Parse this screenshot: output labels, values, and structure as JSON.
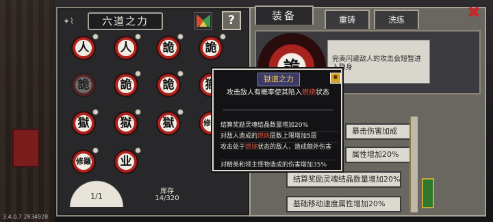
{
  "left_panel": {
    "title": "六道之力",
    "help_label": "?",
    "badges": [
      "人",
      "人",
      "詭",
      "詭",
      "詭",
      "詭",
      "詭",
      "獄",
      "獄",
      "獄",
      "獄",
      "修羅",
      "修羅",
      "业"
    ],
    "fan_page": "1/1",
    "stock_label": "库存",
    "stock_count": "14/320"
  },
  "right_panel": {
    "tabs": [
      "装备",
      "重铸",
      "洗练"
    ],
    "big_badge": "詭",
    "description": "完美闪避敌人的攻击会短暂进入隐身",
    "stats": [
      "暴击伤害加成",
      "属性增加20%",
      "结算奖励灵魂结晶数量增加20%",
      "基础移动速度属性增加20%"
    ]
  },
  "tooltip": {
    "title": "獄道之力",
    "main_before": "攻击敌人有概率使其陷入",
    "main_fire": "燃烧",
    "main_after": "状态",
    "lines": [
      {
        "before": "结算奖励灵魂结晶数量增加20%",
        "fire": "",
        "after": ""
      },
      {
        "before": "对敌人造成的",
        "fire": "燃烧",
        "after": "层数上限增加5层"
      },
      {
        "before": "攻击处于",
        "fire": "燃烧",
        "after": "状态的敌人，造成额外伤害"
      },
      {
        "before": "对精英和领主怪物造成的伤害增加35%",
        "fire": "",
        "after": ""
      }
    ]
  },
  "version": "3.4.0.7 2834928",
  "colors": {
    "accent_red": "#b0221e",
    "fire": "#e0553a",
    "panel_border": "#a9a396"
  }
}
